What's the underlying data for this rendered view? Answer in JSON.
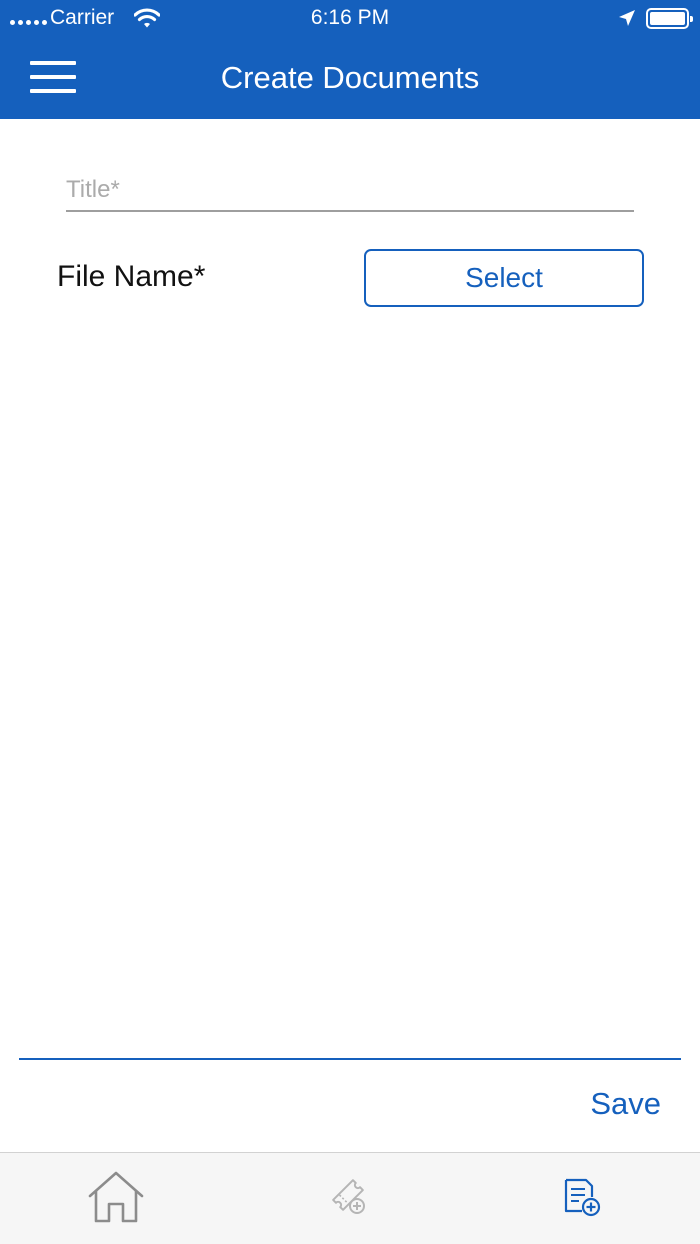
{
  "status_bar": {
    "carrier": "Carrier",
    "time": "6:16 PM"
  },
  "header": {
    "title": "Create Documents",
    "menu_icon": "hamburger-menu-icon"
  },
  "form": {
    "title_placeholder": "Title*",
    "title_value": "",
    "file_name_label": "File Name*",
    "select_label": "Select"
  },
  "footer": {
    "save_label": "Save"
  },
  "tab_bar": {
    "items": [
      {
        "icon": "home-icon",
        "active": false
      },
      {
        "icon": "ticket-add-icon",
        "active": false
      },
      {
        "icon": "document-add-icon",
        "active": true
      }
    ]
  },
  "colors": {
    "primary": "#1560bd",
    "inactive_icon": "#8c8c8c",
    "disabled_icon": "#b5b5b5"
  }
}
